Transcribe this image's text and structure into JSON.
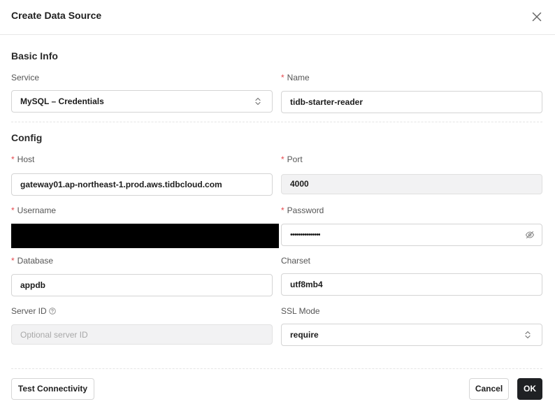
{
  "dialog": {
    "title": "Create Data Source"
  },
  "sections": {
    "basic": "Basic Info",
    "config": "Config"
  },
  "fields": {
    "service": {
      "label": "Service",
      "value": "MySQL – Credentials"
    },
    "name": {
      "label": "Name",
      "value": "tidb-starter-reader"
    },
    "host": {
      "label": "Host",
      "value": "gateway01.ap-northeast-1.prod.aws.tidbcloud.com"
    },
    "port": {
      "label": "Port",
      "value": "4000"
    },
    "username": {
      "label": "Username"
    },
    "password": {
      "label": "Password",
      "value": "•••••••••••••••"
    },
    "database": {
      "label": "Database",
      "value": "appdb"
    },
    "charset": {
      "label": "Charset",
      "value": "utf8mb4"
    },
    "server_id": {
      "label": "Server ID",
      "placeholder": "Optional server ID"
    },
    "ssl_mode": {
      "label": "SSL Mode",
      "value": "require"
    }
  },
  "required_mark": "*",
  "buttons": {
    "test": "Test Connectivity",
    "cancel": "Cancel",
    "ok": "OK"
  },
  "icons": {
    "close": "close-icon",
    "select": "chevron-up-down-icon",
    "password_toggle": "eye-off-icon",
    "help": "question-circle-icon"
  },
  "colors": {
    "required": "#e5484d",
    "primary_button": "#1f2124",
    "redaction": "#000000"
  }
}
